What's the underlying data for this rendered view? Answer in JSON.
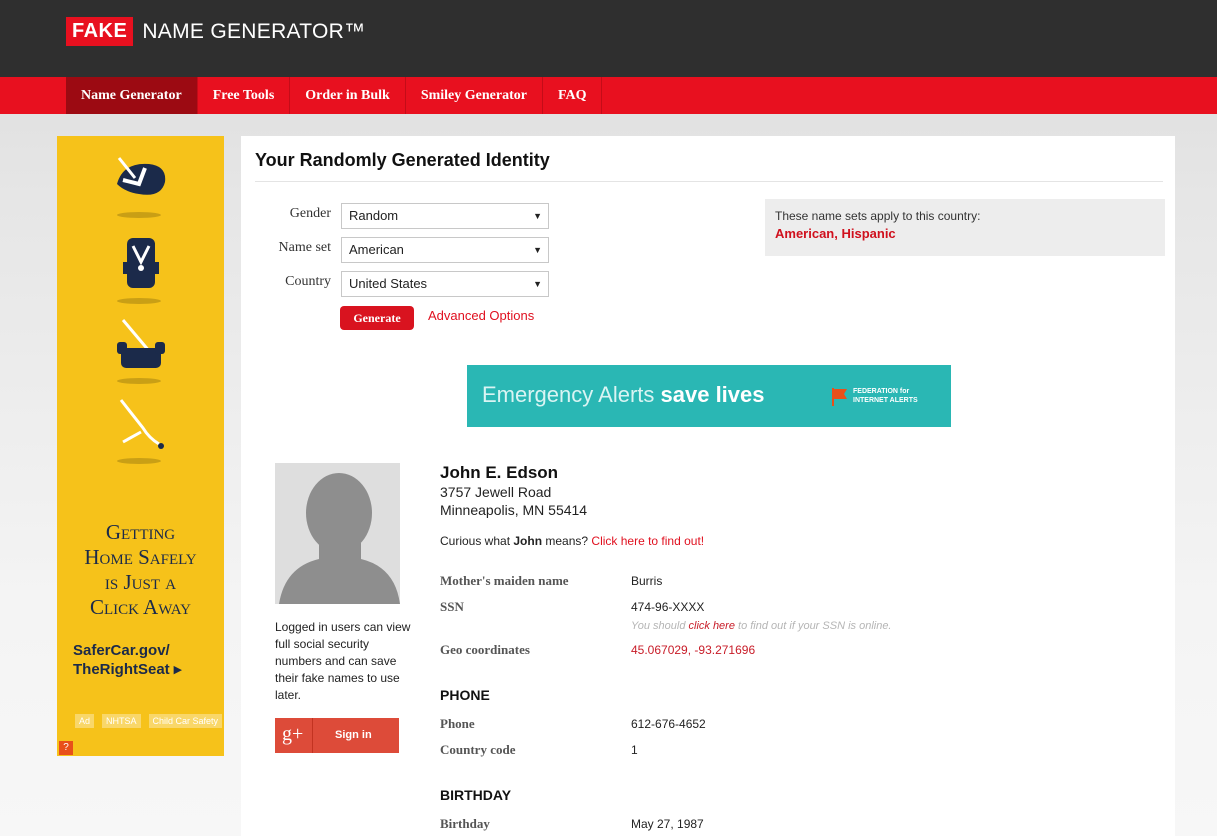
{
  "header": {
    "logo_badge": "FAKE",
    "logo_text": "NAME GENERATOR™"
  },
  "nav": {
    "items": [
      "Name Generator",
      "Free Tools",
      "Order in Bulk",
      "Smiley Generator",
      "FAQ"
    ],
    "active_index": 0
  },
  "ad": {
    "headline": [
      "Getting",
      "Home Safely",
      "is Just a",
      "Click Away"
    ],
    "link_line1": "SaferCar.gov/",
    "link_line2": "TheRightSeat ▸",
    "logos": [
      "Ad",
      "NHTSA",
      "Child Car Safety"
    ],
    "badge": "?"
  },
  "main": {
    "title": "Your Randomly Generated Identity",
    "form": {
      "gender_label": "Gender",
      "gender_value": "Random",
      "nameset_label": "Name set",
      "nameset_value": "American",
      "country_label": "Country",
      "country_value": "United States",
      "generate_label": "Generate",
      "advanced_label": "Advanced Options"
    },
    "note": {
      "text": "These name sets apply to this country:",
      "countries": "American, Hispanic"
    },
    "banner": {
      "text_light": "Emergency Alerts ",
      "text_bold": "save lives",
      "org_line1": "FEDERATION for",
      "org_line2": "INTERNET ALERTS"
    },
    "identity": {
      "name": "John E. Edson",
      "street": "3757 Jewell Road",
      "city": "Minneapolis, MN 55414",
      "curious_prefix": "Curious what ",
      "curious_name": "John",
      "curious_mid": " means? ",
      "curious_link": "Click here to find out!",
      "login_note": "Logged in users can view full social security numbers and can save their fake names to use later.",
      "signin_label": "Sign in",
      "gplus_glyph": "g+",
      "maiden_label": "Mother's maiden name",
      "maiden_value": "Burris",
      "ssn_label": "SSN",
      "ssn_value": "474-96-XXXX",
      "ssn_note_pre": "You should ",
      "ssn_note_link": "click here",
      "ssn_note_post": " to find out if your SSN is online.",
      "geo_label": "Geo coordinates",
      "geo_value": "45.067029, -93.271696",
      "phone_section": "PHONE",
      "phone_label": "Phone",
      "phone_value": "612-676-4652",
      "cc_label": "Country code",
      "cc_value": "1",
      "birthday_section": "BIRTHDAY",
      "birthday_label": "Birthday",
      "birthday_value": "May 27, 1987"
    }
  },
  "colors": {
    "brand_red": "#e8101f",
    "header_dark": "#2f2f2f",
    "ad_yellow": "#f6c21a",
    "banner_teal": "#2ab7b4"
  }
}
